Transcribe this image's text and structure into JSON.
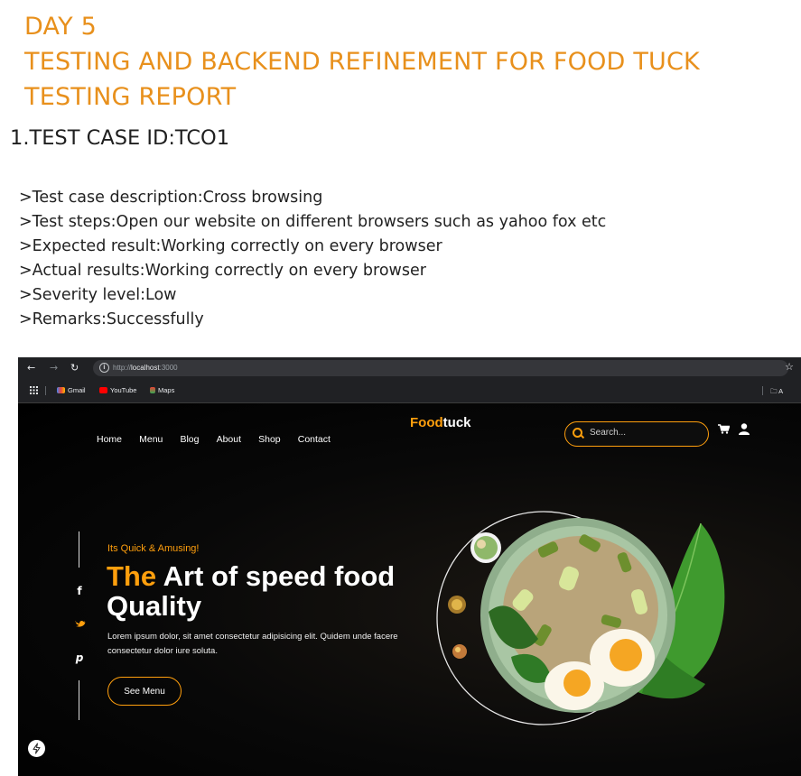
{
  "document": {
    "title_lines": [
      "DAY 5",
      "TESTING AND BACKEND REFINEMENT FOR FOOD TUCK",
      "TESTING REPORT"
    ],
    "test_case_heading": "1.TEST CASE ID:TCO1",
    "details": [
      ">Test case description:Cross browsing",
      ">Test steps:Open our website on different browsers such as yahoo fox etc",
      ">Expected result:Working correctly on every browser",
      ">Actual results:Working correctly on every browser",
      ">Severity level:Low",
      ">Remarks:Successfully"
    ],
    "title_color": "#e8901c"
  },
  "browser": {
    "url_prefix": "http://",
    "url_host": "localhost",
    "url_port": ":3000",
    "bookmarks": [
      "Gmail",
      "YouTube",
      "Maps"
    ],
    "trailing_bookmark": "A",
    "icons": [
      "back-icon",
      "forward-icon",
      "reload-icon",
      "info-icon",
      "star-icon",
      "apps-icon",
      "folder-icon"
    ]
  },
  "site": {
    "nav": [
      "Home",
      "Menu",
      "Blog",
      "About",
      "Shop",
      "Contact"
    ],
    "logo_accent": "Food",
    "logo_rest": "tuck",
    "search_placeholder": "Search...",
    "tagline": "Its Quick & Amusing!",
    "hero_accent": "The",
    "hero_line1_rest": " Art of speed food",
    "hero_line2": "Quality",
    "lorem": "Lorem ipsum dolor, sit amet consectetur adipisicing elit. Quidem unde facere consectetur dolor iure soluta.",
    "button": "See Menu",
    "accent_color": "#ff9f0d",
    "icons": [
      "search-icon",
      "cart-icon",
      "user-icon",
      "facebook-icon",
      "twitter-icon",
      "pinterest-icon",
      "bolt-icon"
    ]
  }
}
